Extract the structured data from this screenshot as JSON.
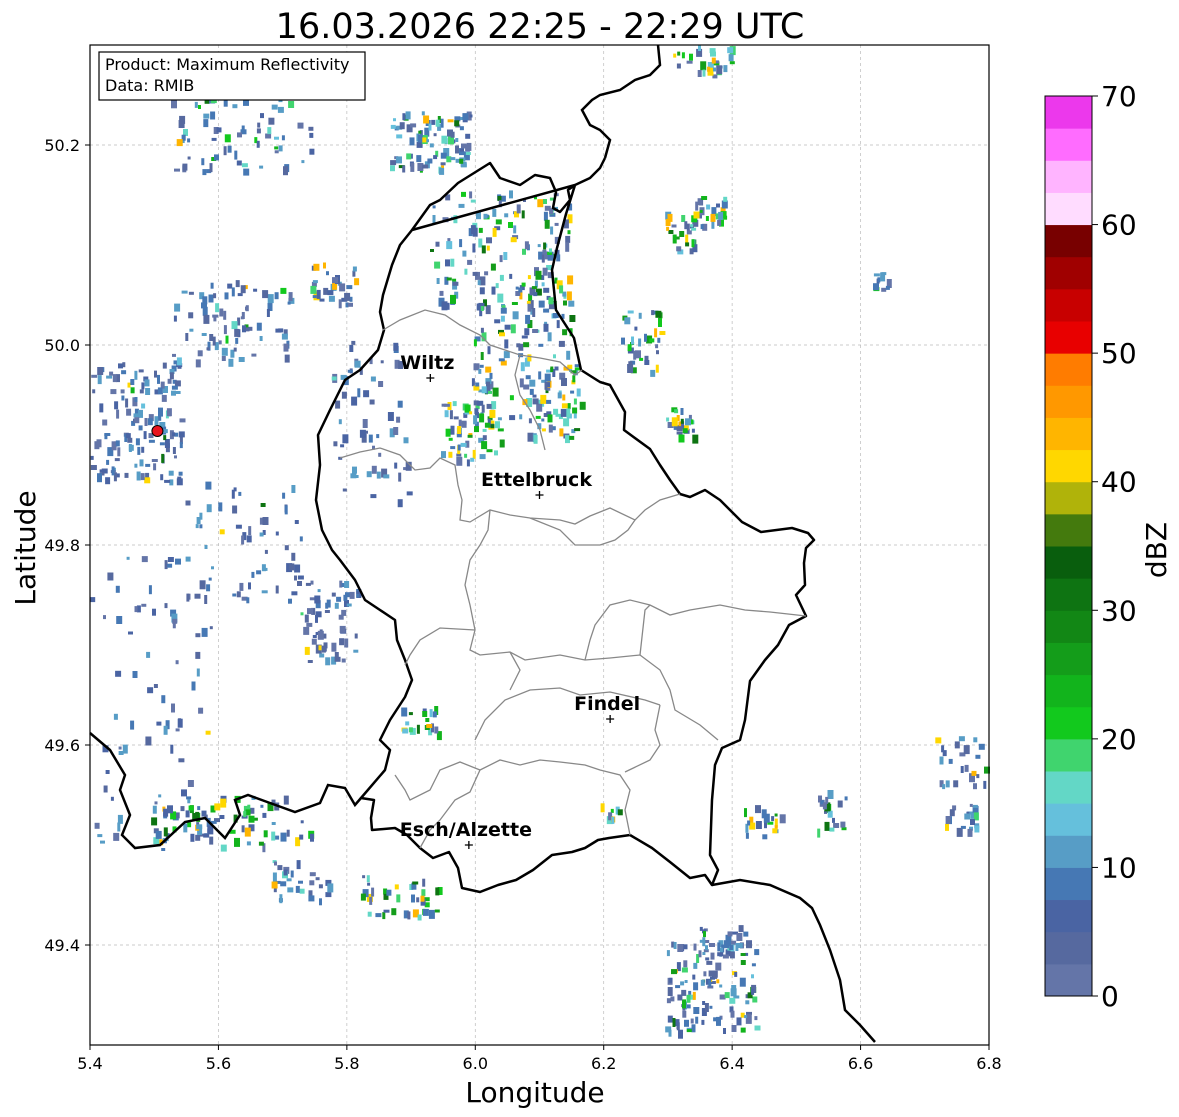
{
  "title": "16.03.2026 22:25 - 22:29 UTC",
  "info_box": {
    "line1": "Product: Maximum Reflectivity",
    "line2": "Data: RMIB"
  },
  "axes": {
    "xlabel": "Longitude",
    "ylabel": "Latitude",
    "xlim": [
      5.4,
      6.8
    ],
    "ylim": [
      49.3,
      50.3
    ],
    "xticks": [
      "5.4",
      "5.6",
      "5.8",
      "6.0",
      "6.2",
      "6.4",
      "6.6",
      "6.8"
    ],
    "yticks": [
      "49.4",
      "49.6",
      "49.8",
      "50.0",
      "50.2"
    ],
    "grid": true
  },
  "colorbar": {
    "label": "dBZ",
    "ticks": [
      "0",
      "10",
      "20",
      "30",
      "40",
      "50",
      "60",
      "70"
    ],
    "colors": [
      "#6475a8",
      "#56699f",
      "#4a64a3",
      "#4678b4",
      "#579dc6",
      "#65c0dc",
      "#63d7c6",
      "#40d46e",
      "#12c91d",
      "#12b41c",
      "#149d1a",
      "#128715",
      "#0e7412",
      "#095e0d",
      "#447a0d",
      "#b0b30a",
      "#ffd700",
      "#ffb500",
      "#ff9800",
      "#ff7c00",
      "#e80000",
      "#c80000",
      "#a00000",
      "#780000",
      "#ffdcff",
      "#ffb4ff",
      "#ff6cff",
      "#ec38ec"
    ]
  },
  "cities": [
    {
      "name": "Wiltz",
      "lon": 5.93,
      "lat": 49.967
    },
    {
      "name": "Ettelbruck",
      "lon": 6.1,
      "lat": 49.85
    },
    {
      "name": "Findel",
      "lon": 6.21,
      "lat": 49.626
    },
    {
      "name": "Esch/Alzette",
      "lon": 5.99,
      "lat": 49.5
    }
  ],
  "radar_site": {
    "lon": 5.505,
    "lat": 49.914,
    "color": "#e8141e"
  }
}
